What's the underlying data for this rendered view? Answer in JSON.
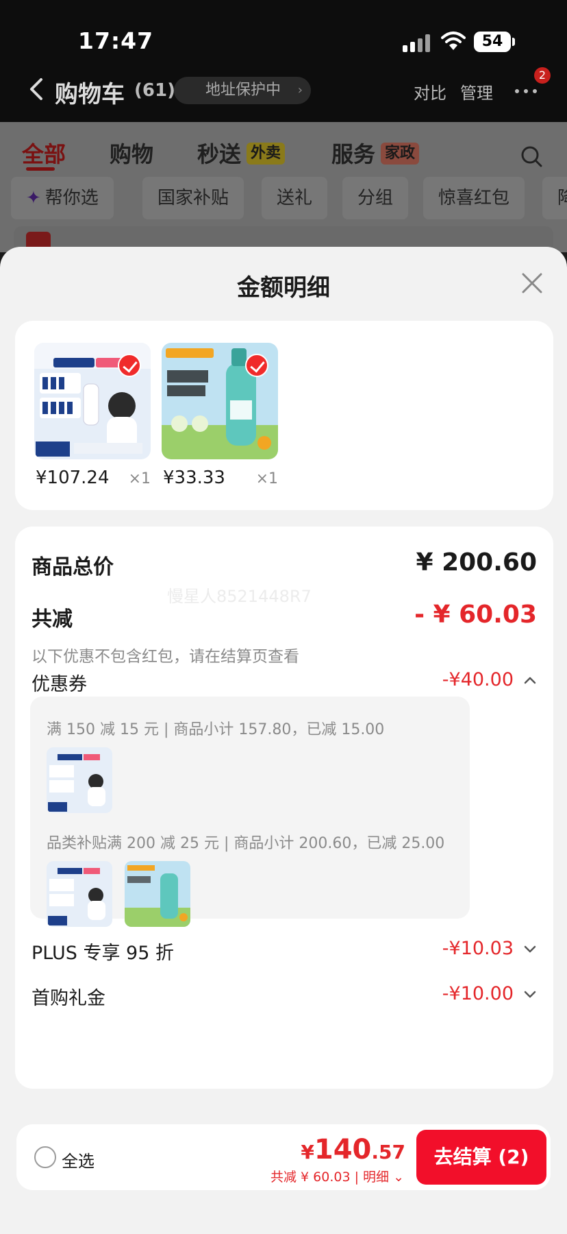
{
  "status_bar": {
    "time": "17:47",
    "battery": "54"
  },
  "nav": {
    "title": "购物车",
    "count": "(61)",
    "address_pill": "地址保护中",
    "compare": "对比",
    "manage": "管理",
    "badge": "2"
  },
  "tabs": [
    {
      "label": "全部"
    },
    {
      "label": "购物"
    },
    {
      "label": "秒送",
      "tag": "外卖"
    },
    {
      "label": "服务",
      "tag": "家政"
    }
  ],
  "chips": [
    "帮你选",
    "国家补贴",
    "送礼",
    "分组",
    "惊喜红包",
    "降"
  ],
  "sheet": {
    "title": "金额明细",
    "products": [
      {
        "price": "¥107.24",
        "qty": "×1"
      },
      {
        "price": "¥33.33",
        "qty": "×1"
      }
    ],
    "summary": {
      "total_label": "商品总价",
      "total_value": "¥ 200.60",
      "discount_label": "共减",
      "discount_value": "- ¥ 60.03",
      "note": "以下优惠不包含红包，请在结算页查看",
      "watermark": "慢星人8521448R7"
    },
    "coupon": {
      "label": "优惠券",
      "value": "-¥40.00",
      "details": [
        "满 150 减 15 元 | 商品小计 157.80，已减 15.00",
        "品类补贴满 200 减 25 元 | 商品小计 200.60，已减 25.00"
      ]
    },
    "plus": {
      "label": "PLUS 专享 95 折",
      "value": "-¥10.03"
    },
    "first_order": {
      "label": "首购礼金",
      "value": "-¥10.00"
    }
  },
  "bottom_bar": {
    "select_all": "全选",
    "total_currency": "¥",
    "total_int": "140",
    "total_dec": ".57",
    "savings": "共减 ¥ 60.03 | 明细",
    "checkout": "去结算 (2)"
  },
  "colors": {
    "accent_red": "#e4262a",
    "checkout_red": "#f20f2a",
    "sheet_bg": "#f2f2f2"
  }
}
